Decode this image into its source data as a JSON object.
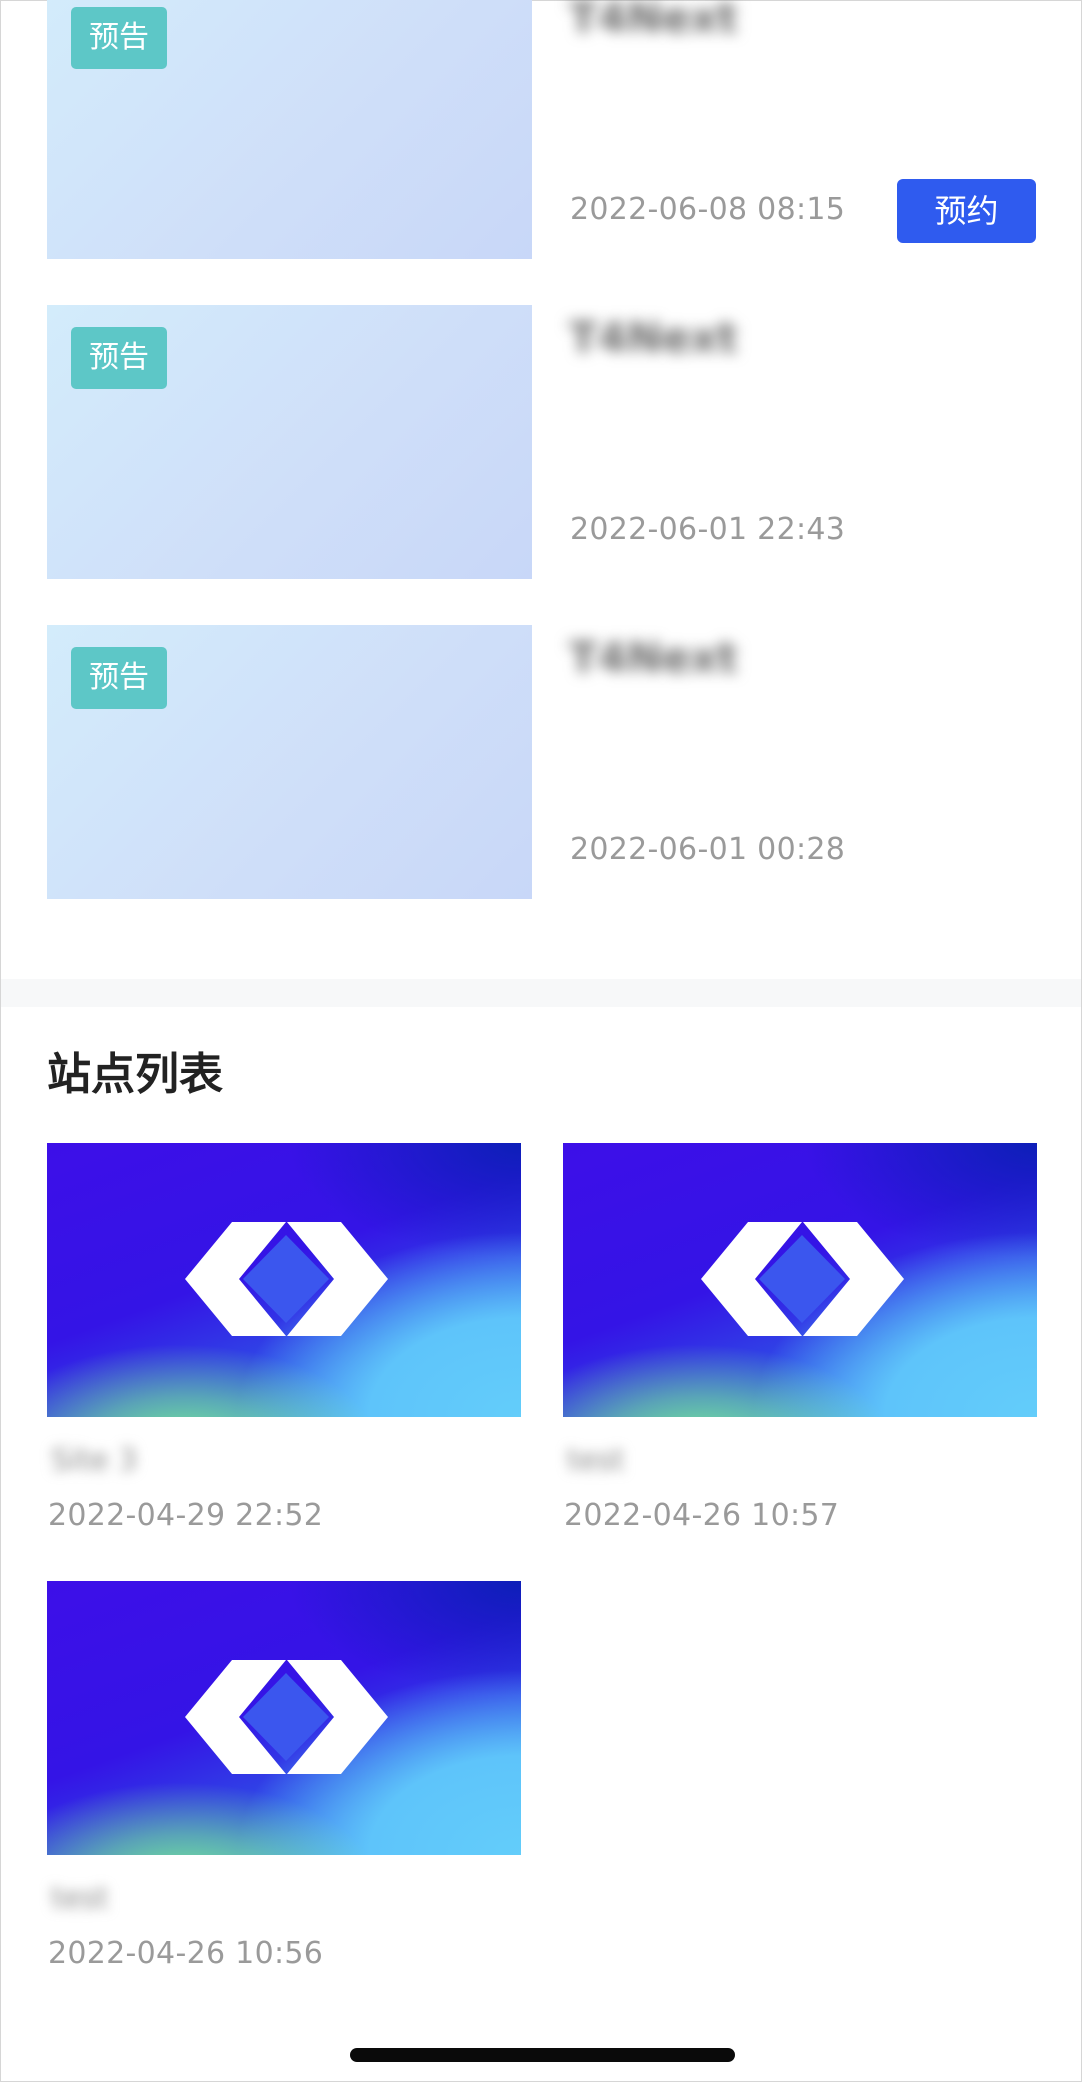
{
  "preview_list": {
    "items": [
      {
        "badge": "预告",
        "title": "T4Next",
        "time": "2022-06-08 08:15",
        "action_label": "预约"
      },
      {
        "badge": "预告",
        "title": "T4Next",
        "time": "2022-06-01 22:43"
      },
      {
        "badge": "预告",
        "title": "T4Next",
        "time": "2022-06-01 00:28"
      }
    ]
  },
  "site_list": {
    "title": "站点列表",
    "items": [
      {
        "name": "Site 3",
        "time": "2022-04-29 22:52",
        "thumbnail_icon": "diamond-logo-icon"
      },
      {
        "name": "test",
        "time": "2022-04-26 10:57",
        "thumbnail_icon": "diamond-logo-icon"
      },
      {
        "name": "test",
        "time": "2022-04-26 10:56",
        "thumbnail_icon": "diamond-logo-icon"
      }
    ]
  },
  "colors": {
    "badge": "#5dc7c7",
    "primary_button": "#2f5bef",
    "time_text": "#9a9a9a",
    "section_title": "#222222"
  }
}
